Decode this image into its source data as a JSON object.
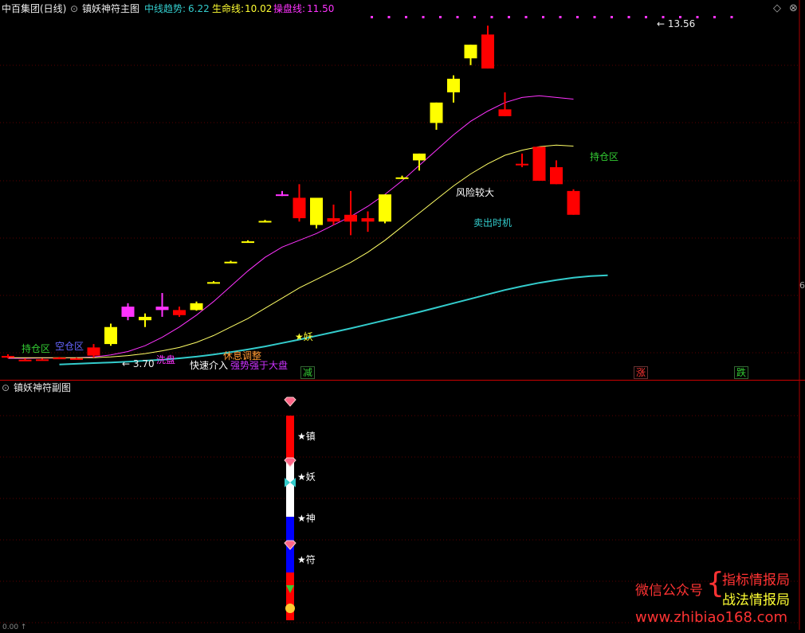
{
  "header": {
    "stock": "中百集团(日线)",
    "indicator": "镇妖神符主图",
    "items": [
      {
        "label": "中线趋势:",
        "value": "6.22",
        "color": "#33cccc"
      },
      {
        "label": "生命线:",
        "value": "10.02",
        "color": "#ffff33"
      },
      {
        "label": "操盘线:",
        "value": "11.50",
        "color": "#ff33ff"
      }
    ]
  },
  "sub_panel": {
    "title": "镇妖神符副图"
  },
  "annotations": {
    "hold_zone_left": "持仓区",
    "empty_zone": "空仓区",
    "low_price": "← 3.70",
    "washing": "洗盘",
    "fast_entry": "快速介入",
    "breath": "休息调整",
    "strong": "强势强于大盘",
    "star_yao": "★妖",
    "risk": "风险较大",
    "sell_time": "卖出时机",
    "hold_zone_right": "持仓区",
    "high_price": "← 13.56",
    "right_axis": "6"
  },
  "badges": [
    {
      "text": "减",
      "color": "#33cc33"
    },
    {
      "text": "涨",
      "color": "#ff3333"
    },
    {
      "text": "跌",
      "color": "#33cc33"
    }
  ],
  "seal": [
    {
      "text": "★镇"
    },
    {
      "text": "★妖"
    },
    {
      "text": "★神"
    },
    {
      "text": "★符"
    }
  ],
  "watermark": {
    "wechat": "微信公众号",
    "brace": "{",
    "line1": "指标情报局",
    "line2": "战法情报局",
    "url": "www.zhibiao168.com"
  },
  "bottom": {
    "left_value": "0.00 ↑"
  },
  "colors": {
    "up": "#ff0000",
    "down_yellow": "#ffff00",
    "magenta": "#ff33ff",
    "life": "#ffff66",
    "trend": "#33cccc",
    "grid": "#8b0000"
  },
  "chart_data": {
    "type": "candlestick",
    "title": "",
    "candles": [
      {
        "o": 3.85,
        "h": 3.9,
        "l": 3.78,
        "c": 3.8,
        "color": "red"
      },
      {
        "o": 3.74,
        "h": 3.78,
        "l": 3.7,
        "c": 3.72,
        "color": "red"
      },
      {
        "o": 3.75,
        "h": 3.78,
        "l": 3.73,
        "c": 3.74,
        "color": "red"
      },
      {
        "o": 3.8,
        "h": 3.82,
        "l": 3.76,
        "c": 3.79,
        "color": "red"
      },
      {
        "o": 3.78,
        "h": 3.8,
        "l": 3.74,
        "c": 3.77,
        "color": "red"
      },
      {
        "o": 3.86,
        "h": 4.2,
        "l": 3.8,
        "c": 4.1,
        "color": "red"
      },
      {
        "o": 4.2,
        "h": 4.8,
        "l": 4.15,
        "c": 4.7,
        "color": "yellow"
      },
      {
        "o": 5.0,
        "h": 5.4,
        "l": 4.9,
        "c": 5.3,
        "color": "magenta"
      },
      {
        "o": 4.9,
        "h": 5.1,
        "l": 4.7,
        "c": 5.0,
        "color": "yellow"
      },
      {
        "o": 5.3,
        "h": 5.7,
        "l": 5.0,
        "c": 5.2,
        "color": "magenta"
      },
      {
        "o": 5.2,
        "h": 5.3,
        "l": 5.0,
        "c": 5.05,
        "color": "red"
      },
      {
        "o": 5.2,
        "h": 5.45,
        "l": 5.18,
        "c": 5.4,
        "color": "yellow"
      },
      {
        "o": 6.0,
        "h": 6.05,
        "l": 5.98,
        "c": 6.02,
        "color": "yellow"
      },
      {
        "o": 6.6,
        "h": 6.65,
        "l": 6.58,
        "c": 6.62,
        "color": "yellow"
      },
      {
        "o": 7.2,
        "h": 7.25,
        "l": 7.18,
        "c": 7.22,
        "color": "yellow"
      },
      {
        "o": 7.8,
        "h": 7.85,
        "l": 7.78,
        "c": 7.82,
        "color": "yellow"
      },
      {
        "o": 8.6,
        "h": 8.7,
        "l": 8.55,
        "c": 8.6,
        "color": "magenta"
      },
      {
        "o": 8.5,
        "h": 8.9,
        "l": 7.8,
        "c": 7.9,
        "color": "red"
      },
      {
        "o": 7.7,
        "h": 8.4,
        "l": 7.6,
        "c": 8.5,
        "color": "yellow"
      },
      {
        "o": 7.9,
        "h": 8.3,
        "l": 7.7,
        "c": 7.8,
        "color": "red"
      },
      {
        "o": 7.8,
        "h": 8.7,
        "l": 7.4,
        "c": 8.0,
        "color": "red"
      },
      {
        "o": 7.9,
        "h": 8.1,
        "l": 7.5,
        "c": 7.8,
        "color": "red"
      },
      {
        "o": 7.8,
        "h": 8.3,
        "l": 7.75,
        "c": 8.6,
        "color": "yellow"
      },
      {
        "o": 9.1,
        "h": 9.15,
        "l": 9.05,
        "c": 9.1,
        "color": "yellow"
      },
      {
        "o": 9.6,
        "h": 9.8,
        "l": 9.3,
        "c": 9.8,
        "color": "yellow"
      },
      {
        "o": 10.7,
        "h": 11.3,
        "l": 10.5,
        "c": 11.3,
        "color": "yellow"
      },
      {
        "o": 11.6,
        "h": 12.1,
        "l": 11.3,
        "c": 12.0,
        "color": "yellow"
      },
      {
        "o": 12.6,
        "h": 13.0,
        "l": 12.4,
        "c": 13.0,
        "color": "yellow"
      },
      {
        "o": 13.3,
        "h": 13.56,
        "l": 12.3,
        "c": 12.3,
        "color": "red"
      },
      {
        "o": 11.1,
        "h": 11.6,
        "l": 10.9,
        "c": 10.9,
        "color": "red"
      },
      {
        "o": 9.5,
        "h": 9.8,
        "l": 9.4,
        "c": 9.5,
        "color": "red"
      },
      {
        "o": 10.0,
        "h": 10.0,
        "l": 9.0,
        "c": 9.0,
        "color": "red"
      },
      {
        "o": 9.4,
        "h": 9.6,
        "l": 8.9,
        "c": 8.9,
        "color": "red"
      },
      {
        "o": 8.7,
        "h": 8.75,
        "l": 8.0,
        "c": 8.0,
        "color": "red"
      }
    ],
    "lines": {
      "operate_line": [
        3.78,
        3.78,
        3.79,
        3.79,
        3.8,
        3.82,
        3.88,
        3.98,
        4.15,
        4.4,
        4.7,
        5.05,
        5.45,
        5.9,
        6.35,
        6.75,
        7.05,
        7.25,
        7.45,
        7.7,
        7.95,
        8.25,
        8.6,
        9.0,
        9.45,
        9.9,
        10.35,
        10.75,
        11.05,
        11.3,
        11.45,
        11.5,
        11.45,
        11.4
      ],
      "life_line": [
        3.8,
        3.8,
        3.8,
        3.8,
        3.8,
        3.8,
        3.82,
        3.86,
        3.92,
        4.0,
        4.1,
        4.25,
        4.45,
        4.7,
        4.95,
        5.25,
        5.55,
        5.85,
        6.1,
        6.35,
        6.6,
        6.9,
        7.25,
        7.65,
        8.05,
        8.45,
        8.85,
        9.2,
        9.5,
        9.75,
        9.9,
        10.0,
        10.05,
        10.02
      ],
      "trend_line": [
        3.6,
        3.62,
        3.64,
        3.66,
        3.68,
        3.71,
        3.74,
        3.78,
        3.83,
        3.89,
        3.96,
        4.04,
        4.13,
        4.23,
        4.33,
        4.44,
        4.55,
        4.66,
        4.78,
        4.9,
        5.02,
        5.14,
        5.27,
        5.4,
        5.53,
        5.66,
        5.79,
        5.9,
        6.0,
        6.08,
        6.15,
        6.2,
        6.22
      ]
    },
    "y_range": [
      3.5,
      13.8
    ]
  }
}
